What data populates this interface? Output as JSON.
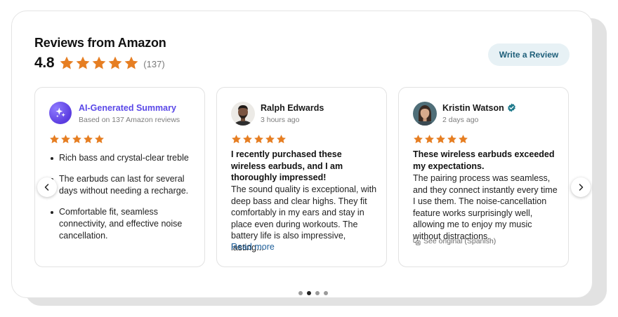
{
  "header": {
    "title": "Reviews from Amazon",
    "rating": "4.8",
    "count": "(137)",
    "write_button": "Write a Review"
  },
  "colors": {
    "star": "#e67e22",
    "button_bg": "#e7f1f5",
    "button_text": "#1e5f7a",
    "ai_accent": "#5a48e8",
    "link": "#1e5f9a"
  },
  "summary": {
    "title": "AI-Generated Summary",
    "subtitle": "Based on 137 Amazon reviews",
    "stars": 5,
    "bullets": [
      "Rich bass and crystal-clear treble",
      "The earbuds can last for several days without needing a recharge.",
      "Comfortable fit, seamless connectivity, and effective noise cancellation."
    ]
  },
  "reviews": [
    {
      "author": "Ralph Edwards",
      "time": "3 hours ago",
      "stars": 5,
      "title": "I recently purchased these wireless earbuds, and I am thoroughly impressed!",
      "body": "The sound quality is exceptional, with deep bass and clear highs. They fit comfortably in my ears and stay in place even during workouts. The battery life is also impressive, lasting...",
      "read_more": "Read more"
    },
    {
      "author": "Kristin Watson",
      "time": "2 days ago",
      "stars": 5,
      "verified": true,
      "title": "These wireless earbuds exceeded my expectations.",
      "body": "The pairing process was seamless, and they connect instantly every time I use them. The noise-cancellation feature works surprisingly well, allowing me to enjoy my music without distractions.",
      "see_original": "See original (Spanish)"
    }
  ],
  "carousel": {
    "prev_icon": "chevron-left-icon",
    "next_icon": "chevron-right-icon",
    "page_count": 4,
    "active_page": 2
  }
}
